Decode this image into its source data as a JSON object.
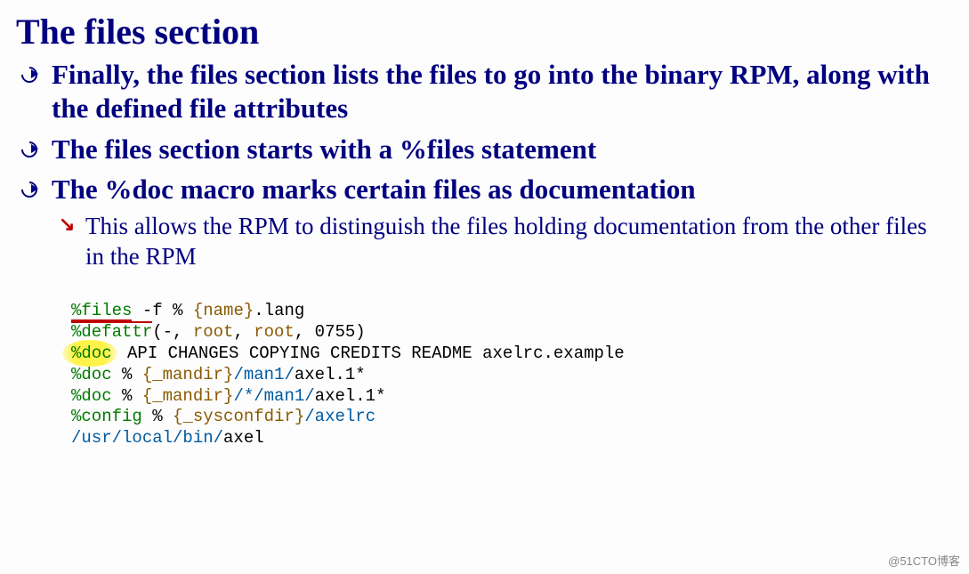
{
  "title": "The files section",
  "bullets": {
    "b1": "Finally, the files section lists the files to go into the binary RPM, along with the defined file attributes",
    "b2a": "The files section starts with a ",
    "b2b": "%files",
    "b2c": " statement",
    "b3a": "The ",
    "b3b": "%doc",
    "b3c": " macro marks certain files as documentation",
    "sub1": "This allows the RPM to distinguish the files holding documentation from the other files in the RPM"
  },
  "code": {
    "l1a": "%files",
    "l1b": " -f % ",
    "l1c": "{name}",
    "l1d": ".lang",
    "l2a": "%defattr",
    "l2b": "(-, ",
    "l2c": "root",
    "l2d": ", ",
    "l2e": "root",
    "l2f": ", 0755)",
    "l3a": "%doc",
    "l3b": " API CHANGES COPYING CREDITS README axelrc.example",
    "l4a": "%doc",
    "l4b": " % ",
    "l4c": "{_mandir}",
    "l4d": "/man1/",
    "l4e": "axel.1*",
    "l5a": "%doc",
    "l5b": " % ",
    "l5c": "{_mandir}",
    "l5d": "/*/man1/",
    "l5e": "axel.1*",
    "l6a": "%config",
    "l6b": " % ",
    "l6c": "{_sysconfdir}",
    "l6d": "/axelrc",
    "l7a": "/usr/local/bin/",
    "l7b": "axel"
  },
  "watermark": "@51CTO博客"
}
